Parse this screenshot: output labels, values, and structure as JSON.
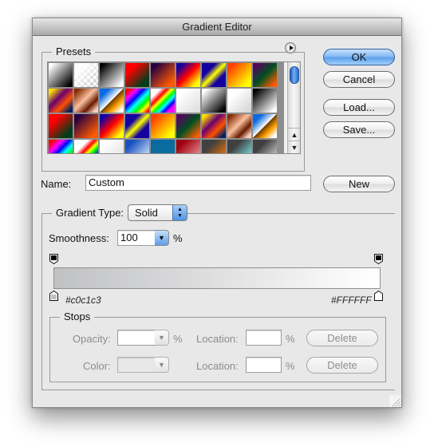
{
  "window": {
    "title": "Gradient Editor"
  },
  "presets": {
    "label": "Presets",
    "menu_icon": "flyout-menu-icon",
    "swatches": [
      "linear-gradient(135deg,#ffffff 10%,#000000 90%)",
      "linear-gradient(135deg,#ffffff 20%,rgba(255,255,255,0) 90%)",
      "linear-gradient(135deg,#000000 10%,#ffffff 90%)",
      "linear-gradient(135deg,#ff0000 25%,#003d1a 80%)",
      "linear-gradient(135deg,#280040 15%,#ff5a00 85%)",
      "linear-gradient(135deg,#1500a0 15%,#ff0000 50%,#ffff00 85%)",
      "linear-gradient(135deg,#1500a0 30%,#ffff00 50%,#1500a0 70%)",
      "linear-gradient(135deg,#ff4000 15%,#ffff00 85%)",
      "linear-gradient(135deg,#5a0060 10%,#005020 50%,#ff5a00 90%)",
      "linear-gradient(135deg,#ffe000 10%,#6a0070 40%,#ff5000 65%,#002060 90%)",
      "linear-gradient(135deg,#8a2a00 10%,#f8c0a0 45%,#6a1a00 70%,#f8d0c0 90%)",
      "linear-gradient(135deg,#0a6ae0 20%,#ffffff 49%,#6a3a00 50%,#ffa000 70%,#ffffff 90%)",
      "linear-gradient(135deg,#ff0000 10%,#ff00ff 25%,#0000ff 40%,#00ffff 55%,#00ff00 70%,#ffff00 82%,#ff0000 95%)",
      "linear-gradient(135deg,#ffffff 20%,#ff0000 35%,#ffff00 45%,#00ff00 55%,#00ffff 65%,#0000ff 75%,#ff00ff 85%)",
      "linear-gradient(135deg,#ffffff 20%,#e0e0e0 90%)",
      "linear-gradient(135deg,#ffffff 10%,#000000 90%)",
      "linear-gradient(135deg,#ffffff 25%,#d8d8d8 90%)",
      "linear-gradient(135deg,#000000 10%,#ffffff 90%)",
      "linear-gradient(135deg,#ff0000 25%,#003d1a 80%)",
      "linear-gradient(135deg,#280040 15%,#ff5a00 85%)",
      "linear-gradient(135deg,#1500a0 15%,#ff0000 50%,#ffff00 85%)",
      "linear-gradient(135deg,#1500a0 30%,#ffff00 50%,#1500a0 70%)",
      "linear-gradient(135deg,#ff4000 15%,#ffff00 85%)",
      "linear-gradient(135deg,#5a0060 10%,#005020 50%,#ff5a00 90%)",
      "linear-gradient(135deg,#ffe000 10%,#6a0070 40%,#ff5000 65%,#002060 90%)",
      "linear-gradient(135deg,#8a2a00 10%,#f8c0a0 45%,#6a1a00 70%,#f8d0c0 90%)",
      "linear-gradient(135deg,#0a6ae0 20%,#ffffff 49%,#6a3a00 50%,#ffa000 70%,#ffffff 90%)",
      "linear-gradient(135deg,#ff0000 10%,#ff00ff 30%,#0000ff 45%,#00ffff 60%,#00ff00 75%,#ffff00 90%)",
      "linear-gradient(135deg,#ffffff 30%,#ff0000 45%,#ffff00 55%,#00ff00 65%,#0000ff 80%)",
      "linear-gradient(135deg,#ffffff 20%,#e0e0e0 90%)",
      "linear-gradient(135deg,#1a50c0 20%,#e0f0ff 90%)",
      "linear-gradient(135deg,#0a6aa0 20%,#0a70a0 90%)",
      "linear-gradient(135deg,#a00010 20%,#f0a0a0 90%)",
      "linear-gradient(135deg,#404040 30%,#ff7a00 90%)",
      "linear-gradient(135deg,#404040 30%,#80f0f0 90%)",
      "linear-gradient(135deg,#404040 30%,#d8d8d8 90%)"
    ]
  },
  "buttons": {
    "ok": "OK",
    "cancel": "Cancel",
    "load": "Load...",
    "save": "Save...",
    "new": "New"
  },
  "name_field": {
    "label": "Name:",
    "value": "Custom"
  },
  "gradient": {
    "type_label": "Gradient Type:",
    "type_value": "Solid",
    "smoothness_label": "Smoothness:",
    "smoothness_value": "100",
    "smoothness_unit": "%",
    "start_color_hex": "#c0c1c3",
    "end_color_hex": "#FFFFFF",
    "start_color": "#c0c1c3",
    "end_color": "#ffffff"
  },
  "stops": {
    "label": "Stops",
    "opacity_label": "Opacity:",
    "opacity_value": "",
    "opacity_unit": "%",
    "opacity_location_label": "Location:",
    "opacity_location_value": "",
    "opacity_location_unit": "%",
    "opacity_delete": "Delete",
    "color_label": "Color:",
    "color_location_label": "Location:",
    "color_location_value": "",
    "color_location_unit": "%",
    "color_delete": "Delete"
  }
}
